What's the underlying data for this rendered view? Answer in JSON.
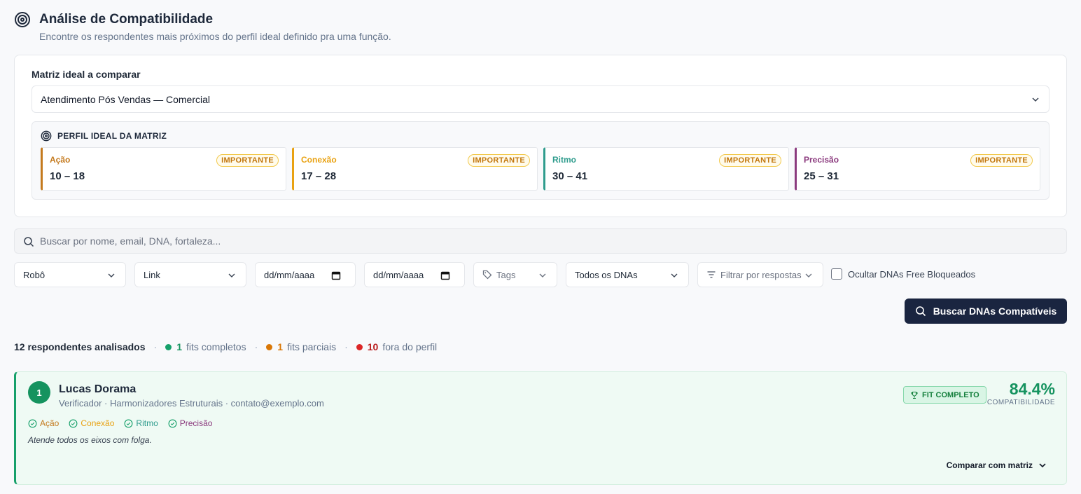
{
  "header": {
    "title": "Análise de Compatibilidade",
    "subtitle": "Encontre os respondentes mais próximos do perfil ideal definido pra uma função."
  },
  "matrix": {
    "label": "Matriz ideal a comparar",
    "selected": "Atendimento Pós Vendas — Comercial",
    "profile_title": "PERFIL IDEAL DA MATRIZ",
    "axes": [
      {
        "name": "Ação",
        "range": "10 – 18",
        "badge": "IMPORTANTE",
        "color": "#c47a1e"
      },
      {
        "name": "Conexão",
        "range": "17 – 28",
        "badge": "IMPORTANTE",
        "color": "#e9a212"
      },
      {
        "name": "Ritmo",
        "range": "30 – 41",
        "badge": "IMPORTANTE",
        "color": "#2f9c8d"
      },
      {
        "name": "Precisão",
        "range": "25 – 31",
        "badge": "IMPORTANTE",
        "color": "#8b3a7e"
      }
    ]
  },
  "search": {
    "placeholder": "Buscar por nome, email, DNA, fortaleza..."
  },
  "filters": {
    "robo": "Robô",
    "link": "Link",
    "date_from": "dd/mm/aaaa",
    "date_to": "dd/mm/aaaa",
    "tags": "Tags",
    "dnas": "Todos os DNAs",
    "responses": "Filtrar por respostas",
    "hide_free": "Ocultar DNAs Free Bloqueados"
  },
  "actions": {
    "search_button": "Buscar DNAs Compatíveis"
  },
  "summary": {
    "total": "12 respondentes analisados",
    "full_fits": "1",
    "full_fits_label": "fits completos",
    "partial_fits": "1",
    "partial_fits_label": "fits parciais",
    "out": "10",
    "out_label": "fora do perfil",
    "colors": {
      "full": "#16a06a",
      "partial": "#d97706",
      "out": "#dc2626"
    }
  },
  "results": [
    {
      "rank": "1",
      "name": "Lucas Dorama",
      "meta": "Verificador · Harmonizadores Estruturais · contato@exemplo.com",
      "badge": "FIT COMPLETO",
      "score": "84.4%",
      "score_label": "COMPATIBILIDADE",
      "axes": [
        "Ação",
        "Conexão",
        "Ritmo",
        "Precisão"
      ],
      "note": "Atende todos os eixos com folga.",
      "compare_label": "Comparar com matriz"
    }
  ]
}
